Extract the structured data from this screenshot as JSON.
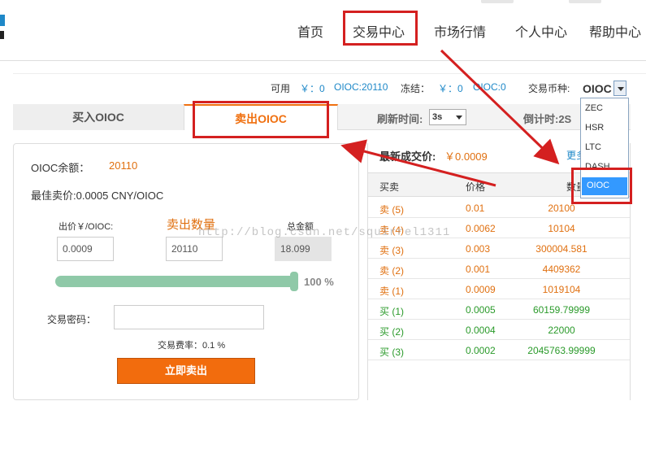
{
  "nav": {
    "items": [
      "首页",
      "交易中心",
      "市场行情",
      "个人中心",
      "帮助中心"
    ]
  },
  "account": {
    "available_label": "可用",
    "available_cny": "￥：0",
    "available_coin": "OIOC:20110",
    "frozen_label": "冻结：",
    "frozen_cny": "￥：0",
    "frozen_coin": "OIOC:0"
  },
  "coin_selector": {
    "label": "交易币种:",
    "selected": "OIOC",
    "options": [
      "ZEC",
      "HSR",
      "LTC",
      "DASH",
      "OIOC"
    ]
  },
  "tabs": {
    "buy": "买入OIOC",
    "sell": "卖出OIOC"
  },
  "refresh": {
    "label": "刷新时间:",
    "value": "3s",
    "countdown": "倒计时:2S"
  },
  "sell_form": {
    "balance_label": "OIOC余额：",
    "balance_value": "20110",
    "best_price": "最佳卖价:0.0005 CNY/OIOC",
    "price_label": "出价￥/OIOC:",
    "price_value": "0.0009",
    "quantity_label": "卖出数量",
    "quantity_value": "20110",
    "total_label": "总金额",
    "total_value": "18.099",
    "slider_percent": "100 %",
    "slider_level": 1.0,
    "password_label": "交易密码：",
    "password_value": "",
    "fee_text": "交易费率：0.1 %",
    "submit_label": "立即卖出"
  },
  "orderbook": {
    "latest_label": "最新成交价:",
    "latest_value": "￥0.0009",
    "more_link": "更多",
    "headers": [
      "买卖",
      "价格",
      "数量"
    ],
    "rows": [
      {
        "side": "卖 (5)",
        "price": "0.01",
        "amount": "20100",
        "type": "sell"
      },
      {
        "side": "卖 (4)",
        "price": "0.0062",
        "amount": "10104",
        "type": "sell"
      },
      {
        "side": "卖 (3)",
        "price": "0.003",
        "amount": "300004.581",
        "type": "sell"
      },
      {
        "side": "卖 (2)",
        "price": "0.001",
        "amount": "4409362",
        "type": "sell"
      },
      {
        "side": "卖 (1)",
        "price": "0.0009",
        "amount": "1019104",
        "type": "sell"
      },
      {
        "side": "买 (1)",
        "price": "0.0005",
        "amount": "60159.79999",
        "type": "buy"
      },
      {
        "side": "买 (2)",
        "price": "0.0004",
        "amount": "22000",
        "type": "buy"
      },
      {
        "side": "买 (3)",
        "price": "0.0002",
        "amount": "2045763.99999",
        "type": "buy"
      }
    ]
  },
  "watermark": "http://blog.csdn.net/squirrel1311",
  "colors": {
    "accent_orange": "#f26c0d",
    "link_blue": "#1e88c8",
    "sell_text": "#e07010",
    "buy_text": "#2a9a2a",
    "annotation_red": "#d42020",
    "slider_green": "#8fc9a8"
  }
}
